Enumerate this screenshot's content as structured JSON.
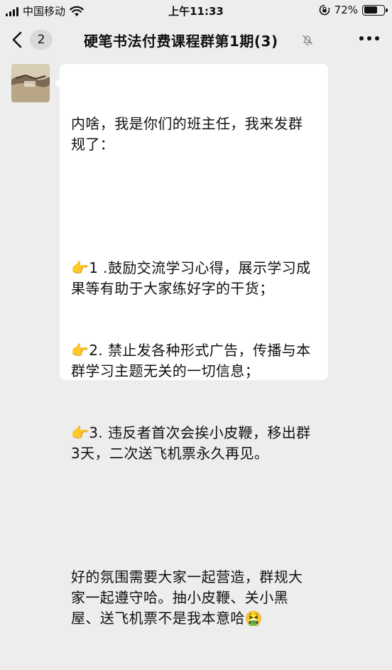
{
  "status_bar": {
    "carrier": "中国移动",
    "time": "上午11:33",
    "battery_percent": "72%",
    "battery_level": 0.72
  },
  "nav": {
    "back_count": "2",
    "title": "硬笔书法付费课程群第1期(3)",
    "icons": [
      "back-icon",
      "mute-icon",
      "more-icon"
    ]
  },
  "message": {
    "lines": [
      "内啥，我是你们的班主任，我来发群规了：",
      "",
      "👉1 .鼓励交流学习心得，展示学习成果等有助于大家练好字的干货；",
      "👉2. 禁止发各种形式广告，传播与本群学习主题无关的一切信息；",
      "👉3. 违反者首次会挨小皮鞭，移出群3天，二次送飞机票永久再见。",
      "",
      "好的氛围需要大家一起营造，群规大家一起遵守哈。抽小皮鞭、关小黑屋、送飞机票不是我本意哈🤮"
    ]
  },
  "colors": {
    "background": "#ededed",
    "bubble": "#ffffff",
    "text": "#111111"
  }
}
